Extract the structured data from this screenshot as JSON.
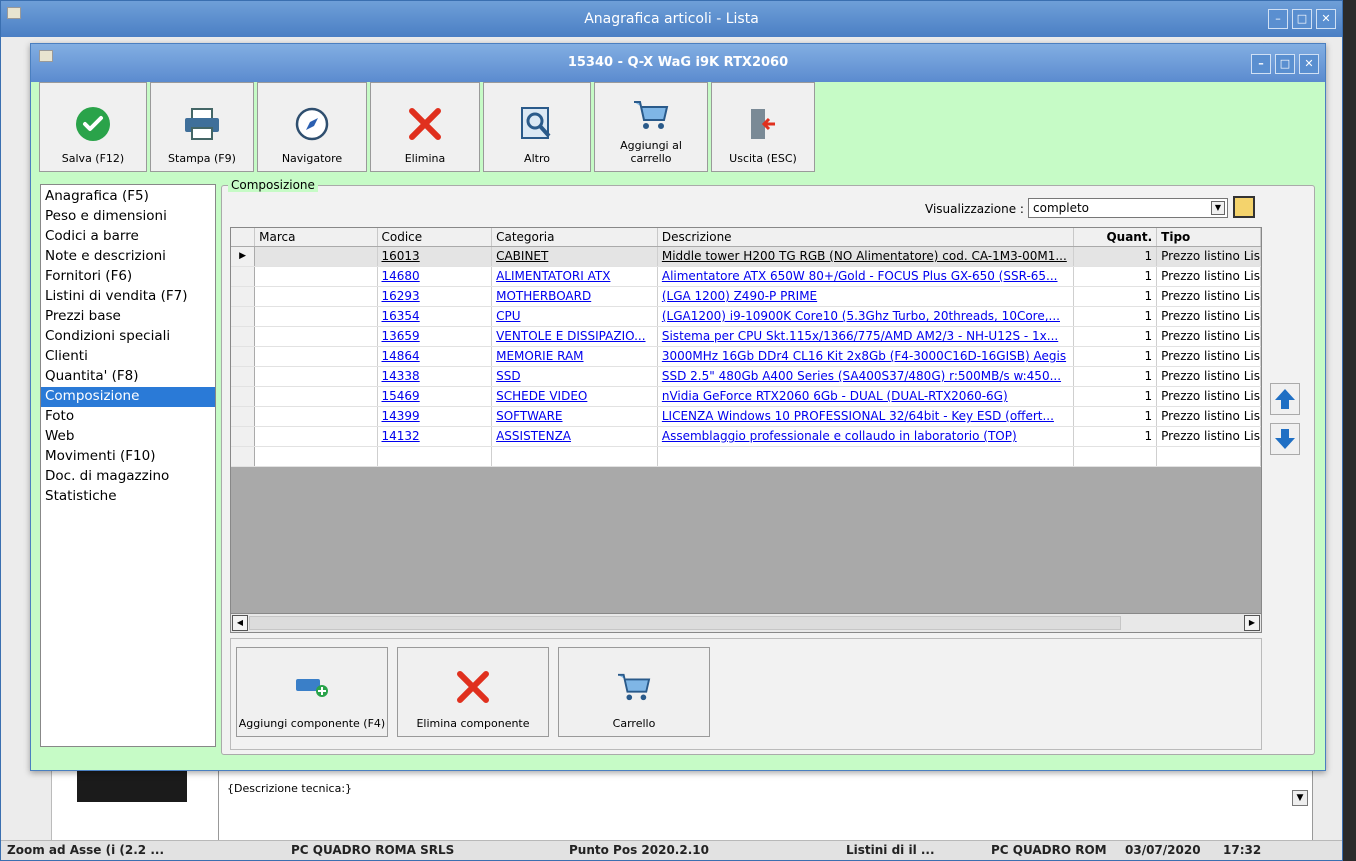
{
  "outer_window": {
    "title": "Anagrafica articoli  - Lista",
    "controls": {
      "minimize": "–",
      "maximize": "□",
      "close": "✕"
    }
  },
  "inner_window": {
    "title": "15340 - Q-X WaG i9K RTX2060",
    "controls": {
      "minimize": "–",
      "maximize": "□",
      "close": "✕"
    }
  },
  "toolbar": {
    "save": "Salva (F12)",
    "print": "Stampa (F9)",
    "navigator": "Navigatore",
    "delete": "Elimina",
    "other": "Altro",
    "add_to_cart": "Aggiungi al carrello",
    "exit": "Uscita (ESC)"
  },
  "sidebar": {
    "items": [
      "Anagrafica (F5)",
      "Peso e dimensioni",
      "Codici a barre",
      "Note e descrizioni",
      "Fornitori (F6)",
      "Listini di vendita (F7)",
      "Prezzi base",
      "Condizioni speciali",
      "Clienti",
      "Quantita' (F8)",
      "Composizione",
      "Foto",
      "Web",
      "Movimenti (F10)",
      "Doc. di magazzino",
      "Statistiche"
    ],
    "selected_index": 10
  },
  "composizione": {
    "legend": "Composizione",
    "view_label": "Visualizzazione :",
    "view_value": "completo",
    "columns": [
      "Marca",
      "Codice",
      "Categoria",
      "Descrizione",
      "Quant.",
      "Tipo"
    ],
    "rows": [
      {
        "marca": "",
        "codice": "16013",
        "categoria": "CABINET",
        "descrizione": "Middle tower H200 TG RGB (NO Alimentatore) cod. CA-1M3-00M1...",
        "quant": "1",
        "tipo": "Prezzo listino Lis"
      },
      {
        "marca": "",
        "codice": "14680",
        "categoria": "ALIMENTATORI ATX",
        "descrizione": "Alimentatore ATX  650W 80+/Gold - FOCUS Plus GX-650 (SSR-65...",
        "quant": "1",
        "tipo": "Prezzo listino Lis"
      },
      {
        "marca": "",
        "codice": "16293",
        "categoria": "MOTHERBOARD",
        "descrizione": "(LGA 1200) Z490-P PRIME",
        "quant": "1",
        "tipo": "Prezzo listino Lis"
      },
      {
        "marca": "",
        "codice": "16354",
        "categoria": "CPU",
        "descrizione": "(LGA1200) i9-10900K Core10 (5.3Ghz Turbo, 20threads, 10Core,...",
        "quant": "1",
        "tipo": "Prezzo listino Lis"
      },
      {
        "marca": "",
        "codice": "13659",
        "categoria": "VENTOLE E DISSIPAZIO...",
        "descrizione": "Sistema per CPU Skt.115x/1366/775/AMD AM2/3 - NH-U12S - 1x...",
        "quant": "1",
        "tipo": "Prezzo listino Lis"
      },
      {
        "marca": "",
        "codice": "14864",
        "categoria": "MEMORIE RAM",
        "descrizione": "3000MHz 16Gb DDr4 CL16 Kit 2x8Gb (F4-3000C16D-16GISB) Aegis",
        "quant": "1",
        "tipo": "Prezzo listino Lis"
      },
      {
        "marca": "",
        "codice": "14338",
        "categoria": "SSD",
        "descrizione": "SSD 2.5\"  480Gb A400 Series (SA400S37/480G) r:500MB/s w:450...",
        "quant": "1",
        "tipo": "Prezzo listino Lis"
      },
      {
        "marca": "",
        "codice": "15469",
        "categoria": "SCHEDE VIDEO",
        "descrizione": "nVidia GeForce RTX2060 6Gb - DUAL (DUAL-RTX2060-6G)",
        "quant": "1",
        "tipo": "Prezzo listino Lis"
      },
      {
        "marca": "",
        "codice": "14399",
        "categoria": "SOFTWARE",
        "descrizione": "LICENZA Windows 10 PROFESSIONAL 32/64bit  - Key ESD (offert...",
        "quant": "1",
        "tipo": "Prezzo listino Lis"
      },
      {
        "marca": "",
        "codice": "14132",
        "categoria": "ASSISTENZA",
        "descrizione": "Assemblaggio professionale e collaudo in laboratorio (TOP)",
        "quant": "1",
        "tipo": "Prezzo listino Lis"
      }
    ],
    "current_row": 0,
    "buttons": {
      "add": "Aggiungi componente (F4)",
      "remove": "Elimina componente",
      "cart": "Carrello"
    }
  },
  "tech_description": "{Descrizione tecnica:}",
  "status_bar": {
    "items": [
      "Zoom ad Asse (i (2.2 ...",
      "PC QUADRO ROMA SRLS",
      "Punto Pos 2020.2.10",
      "Listini di il ...",
      "PC QUADRO ROM",
      "03/07/2020",
      "17:32"
    ]
  },
  "colors": {
    "form_background": "#c6fbc6",
    "selection": "#2a7ad7",
    "title_bar": "#5b8bcf",
    "link": "#0000ee"
  },
  "icons": {
    "save": "check-circle-icon",
    "print": "printer-icon",
    "navigator": "compass-icon",
    "delete": "red-x-icon",
    "other": "magnifier-icon",
    "add_to_cart": "cart-icon",
    "exit": "exit-door-icon",
    "move_up": "arrow-up-icon",
    "move_down": "arrow-down-icon"
  }
}
